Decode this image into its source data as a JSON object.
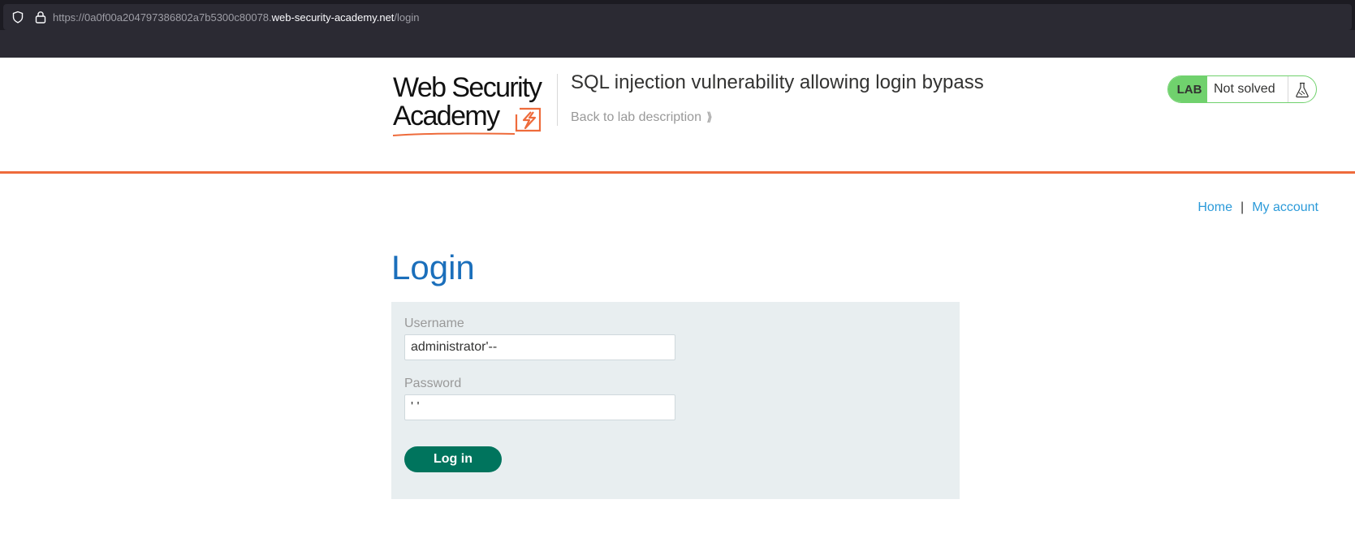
{
  "browser": {
    "url_prefix": "https://0a0f00a204797386802a7b5300c80078.",
    "url_host": "web-security-academy.net",
    "url_path": "/login"
  },
  "header": {
    "logo_line1": "Web Security",
    "logo_line2": "Academy",
    "lab_title": "SQL injection vulnerability allowing login bypass",
    "back_link": "Back to lab description",
    "lab_badge": "LAB",
    "lab_status": "Not solved",
    "accent_color": "#ee6b3b",
    "status_color": "#70d16d"
  },
  "nav": {
    "home": "Home",
    "separator": "|",
    "my_account": "My account"
  },
  "login": {
    "heading": "Login",
    "username_label": "Username",
    "username_value": "administrator'--",
    "password_label": "Password",
    "password_value": "' '",
    "submit_label": "Log in"
  }
}
